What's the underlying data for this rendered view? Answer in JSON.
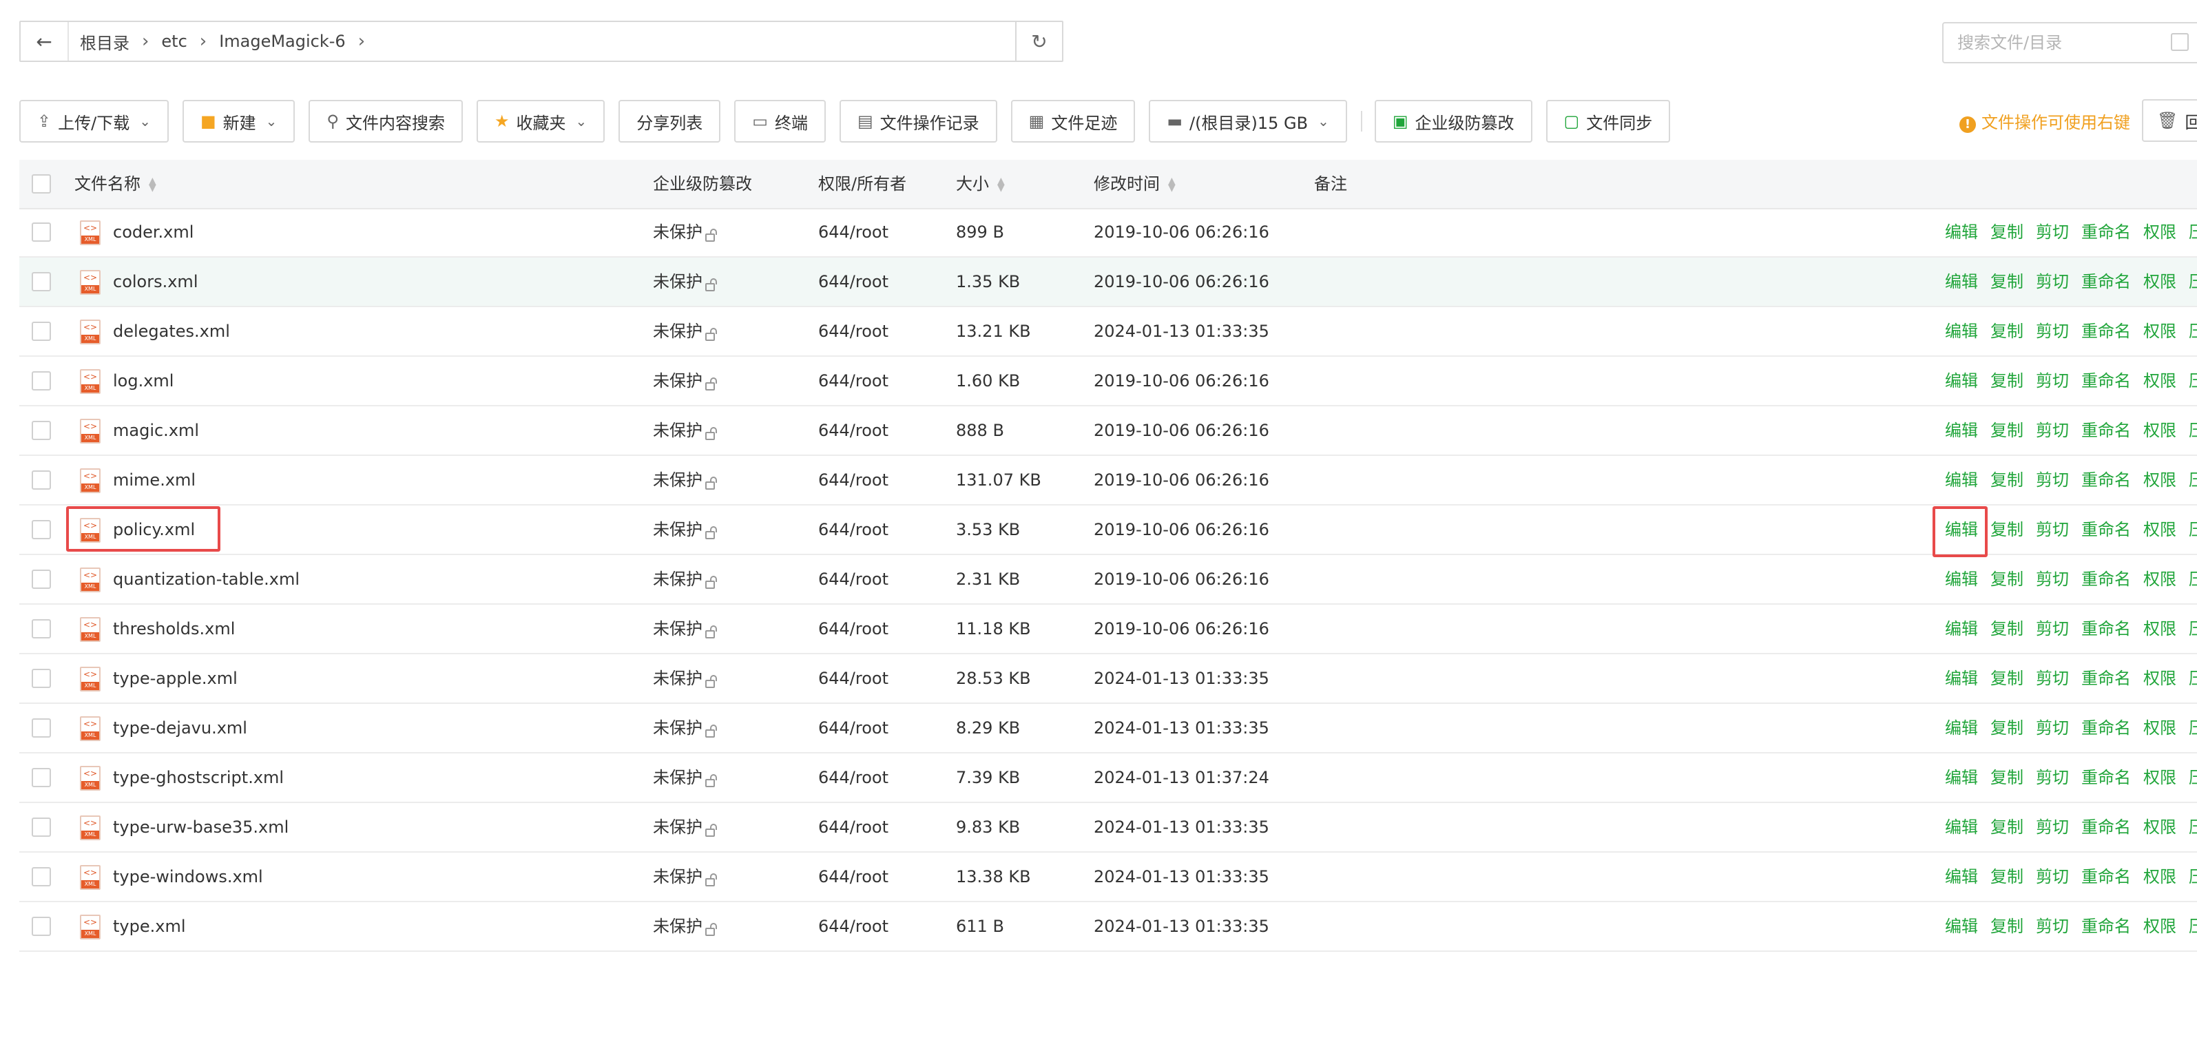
{
  "breadcrumb": {
    "back_icon": "arrow-left-icon",
    "items": [
      "根目录",
      "etc",
      "ImageMagick-6"
    ],
    "refresh_icon": "refresh-icon"
  },
  "search": {
    "placeholder": "搜索文件/目录"
  },
  "toolbar": {
    "upload": "上传/下载",
    "new": "新建",
    "content_search": "文件内容搜索",
    "favorites": "收藏夹",
    "share_list": "分享列表",
    "terminal": "终端",
    "op_log": "文件操作记录",
    "footprint": "文件足迹",
    "disk": "/(根目录)15 GB",
    "tamper": "企业级防篡改",
    "sync": "文件同步",
    "hint": "文件操作可使用右键",
    "recycle": "回"
  },
  "columns": {
    "name": "文件名称",
    "protect": "企业级防篡改",
    "perm": "权限/所有者",
    "size": "大小",
    "mtime": "修改时间",
    "note": "备注"
  },
  "actions": [
    "编辑",
    "复制",
    "剪切",
    "重命名",
    "权限",
    "压"
  ],
  "files": [
    {
      "name": "coder.xml",
      "protect": "未保护",
      "perm": "644/root",
      "size": "899 B",
      "mtime": "2019-10-06 06:26:16"
    },
    {
      "name": "colors.xml",
      "protect": "未保护",
      "perm": "644/root",
      "size": "1.35 KB",
      "mtime": "2019-10-06 06:26:16"
    },
    {
      "name": "delegates.xml",
      "protect": "未保护",
      "perm": "644/root",
      "size": "13.21 KB",
      "mtime": "2024-01-13 01:33:35"
    },
    {
      "name": "log.xml",
      "protect": "未保护",
      "perm": "644/root",
      "size": "1.60 KB",
      "mtime": "2019-10-06 06:26:16"
    },
    {
      "name": "magic.xml",
      "protect": "未保护",
      "perm": "644/root",
      "size": "888 B",
      "mtime": "2019-10-06 06:26:16"
    },
    {
      "name": "mime.xml",
      "protect": "未保护",
      "perm": "644/root",
      "size": "131.07 KB",
      "mtime": "2019-10-06 06:26:16"
    },
    {
      "name": "policy.xml",
      "protect": "未保护",
      "perm": "644/root",
      "size": "3.53 KB",
      "mtime": "2019-10-06 06:26:16"
    },
    {
      "name": "quantization-table.xml",
      "protect": "未保护",
      "perm": "644/root",
      "size": "2.31 KB",
      "mtime": "2019-10-06 06:26:16"
    },
    {
      "name": "thresholds.xml",
      "protect": "未保护",
      "perm": "644/root",
      "size": "11.18 KB",
      "mtime": "2019-10-06 06:26:16"
    },
    {
      "name": "type-apple.xml",
      "protect": "未保护",
      "perm": "644/root",
      "size": "28.53 KB",
      "mtime": "2024-01-13 01:33:35"
    },
    {
      "name": "type-dejavu.xml",
      "protect": "未保护",
      "perm": "644/root",
      "size": "8.29 KB",
      "mtime": "2024-01-13 01:33:35"
    },
    {
      "name": "type-ghostscript.xml",
      "protect": "未保护",
      "perm": "644/root",
      "size": "7.39 KB",
      "mtime": "2024-01-13 01:37:24"
    },
    {
      "name": "type-urw-base35.xml",
      "protect": "未保护",
      "perm": "644/root",
      "size": "9.83 KB",
      "mtime": "2024-01-13 01:33:35"
    },
    {
      "name": "type-windows.xml",
      "protect": "未保护",
      "perm": "644/root",
      "size": "13.38 KB",
      "mtime": "2024-01-13 01:33:35"
    },
    {
      "name": "type.xml",
      "protect": "未保护",
      "perm": "644/root",
      "size": "611 B",
      "mtime": "2024-01-13 01:33:35"
    }
  ],
  "file_icon_label": "XML",
  "colors": {
    "accent": "#20a53a",
    "warning": "#f0a020",
    "highlight": "#e84a4a"
  }
}
